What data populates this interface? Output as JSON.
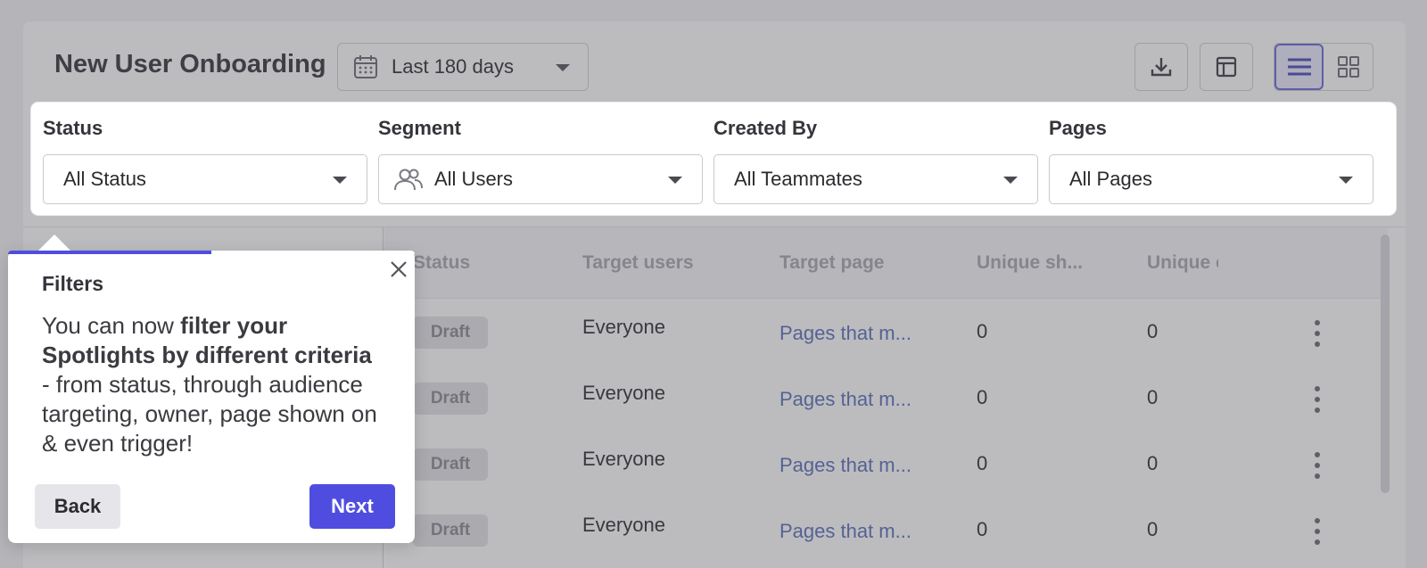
{
  "header": {
    "title": "New User Onboarding",
    "date_range": "Last 180 days",
    "icons": [
      "calendar-icon",
      "download-icon",
      "columns-icon",
      "list-view-icon",
      "grid-view-icon"
    ]
  },
  "filters": [
    {
      "label": "Status",
      "value": "All Status"
    },
    {
      "label": "Segment",
      "value": "All Users",
      "icon": "users-icon"
    },
    {
      "label": "Created By",
      "value": "All Teammates"
    },
    {
      "label": "Pages",
      "value": "All Pages"
    }
  ],
  "table": {
    "columns": [
      "Status",
      "Target users",
      "Target page",
      "Unique sh...",
      "Unique e"
    ],
    "rows": [
      {
        "status": "Draft",
        "target_users": "Everyone",
        "target_page": "Pages that m...",
        "unique_shown": "0",
        "unique_engaged": "0"
      },
      {
        "status": "Draft",
        "target_users": "Everyone",
        "target_page": "Pages that m...",
        "unique_shown": "0",
        "unique_engaged": "0"
      },
      {
        "status": "Draft",
        "target_users": "Everyone",
        "target_page": "Pages that m...",
        "unique_shown": "0",
        "unique_engaged": "0"
      },
      {
        "status": "Draft",
        "target_users": "Everyone",
        "target_page": "Pages that m...",
        "unique_shown": "0",
        "unique_engaged": "0"
      }
    ]
  },
  "tooltip": {
    "title": "Filters",
    "body_pre": "You can now ",
    "body_bold": "filter your Spotlights by different criteria",
    "body_post": " - from status, through audience targeting, owner, page shown on & even trigger!",
    "back_label": "Back",
    "next_label": "Next",
    "progress_fraction": 0.5
  },
  "colors": {
    "accent": "#4f4de0",
    "link": "#5a6fb8",
    "overlay": "rgba(80,80,86,0.38)"
  }
}
